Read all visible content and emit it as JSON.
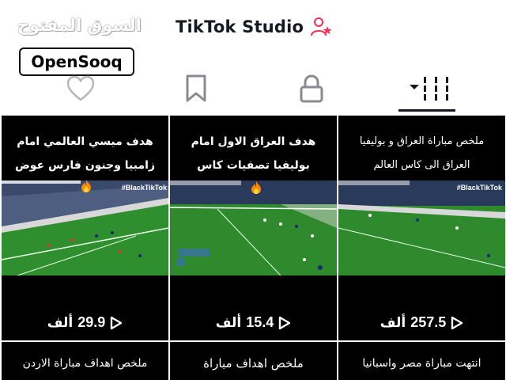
{
  "header": {
    "title": "TikTok Studio",
    "add_user_icon": "add-user-icon"
  },
  "watermark": {
    "arabic": "السوق المفتوح",
    "latin": "OpenSooq"
  },
  "tabs": [
    {
      "icon": "heart-icon",
      "active": false
    },
    {
      "icon": "bookmark-icon",
      "active": false
    },
    {
      "icon": "lock-icon",
      "active": false
    },
    {
      "icon": "grid-icon",
      "active": true
    }
  ],
  "colors": {
    "text": "#161823",
    "accent_pink": "#fe2c55",
    "pitch_green": "#2e8a2c"
  },
  "videos": [
    {
      "caption_line1": "هدف ميسي العالمي امام",
      "caption_line2": "زامبيا وجنون فارس عوض",
      "views": "29.9",
      "unit": "ألف",
      "tag": "#BlackTikTok"
    },
    {
      "caption_line1": "هدف العراق الاول امام",
      "caption_line2": "بوليفيا تصفيات كاس العالم",
      "views": "15.4",
      "unit": "ألف",
      "tag": ""
    },
    {
      "caption_line1": "ملخص مباراة العراق و بوليفيا",
      "caption_line2": "العراق الى كاس العالم",
      "views": "257.5",
      "unit": "ألف",
      "tag": "#BlackTikTok"
    }
  ],
  "row2": [
    {
      "caption": "ملخص اهداف مباراة الاردن"
    },
    {
      "caption": "ملخص اهداف مباراة"
    },
    {
      "caption": "انتهت مباراة مصر واسبانيا"
    }
  ]
}
